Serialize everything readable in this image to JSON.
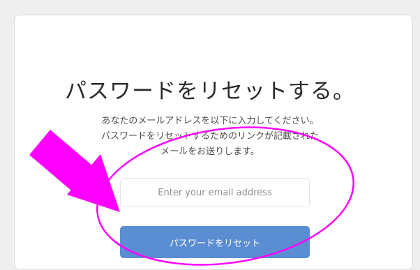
{
  "page": {
    "title": "パスワードをリセットする。",
    "description": "あなたのメールアドレスを以下に入力してください。パスワードをリセットするためのリンクが記載されたメールをお送りします。"
  },
  "form": {
    "email_placeholder": "Enter your email address",
    "email_value": "",
    "submit_label": "パスワードをリセット"
  },
  "annotation": {
    "arrow_color": "#ff00ff",
    "ellipse_color": "#ff00ff"
  }
}
